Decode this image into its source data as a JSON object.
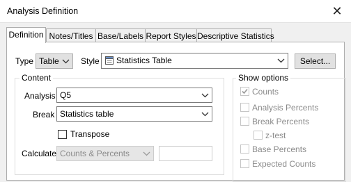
{
  "window": {
    "title": "Analysis Definition",
    "close_glyph": "✕"
  },
  "tabs": [
    {
      "label": "Definition",
      "active": true
    },
    {
      "label": "Notes/Titles",
      "active": false
    },
    {
      "label": "Base/Labels",
      "active": false
    },
    {
      "label": "Report Styles",
      "active": false
    },
    {
      "label": "Descriptive Statistics",
      "active": false
    }
  ],
  "definition": {
    "type_label": "Type",
    "type_value": "Table",
    "style_label": "Style",
    "style_value": "Statistics Table",
    "style_icon": "document-icon",
    "select_button": "Select..."
  },
  "content": {
    "legend": "Content",
    "analysis_label": "Analysis",
    "analysis_value": "Q5",
    "break_label": "Break",
    "break_value": "Statistics table",
    "transpose_label": "Transpose",
    "transpose_checked": false,
    "calculate_label": "Calculate",
    "calculate_value": "Counts & Percents",
    "calculate_extra_value": ""
  },
  "show_options": {
    "legend": "Show options",
    "items": [
      {
        "label": "Counts",
        "checked": true
      },
      {
        "label": "Analysis Percents",
        "checked": false
      },
      {
        "label": "Break Percents",
        "checked": false
      },
      {
        "label": "z-test",
        "checked": false
      },
      {
        "label": "Base Percents",
        "checked": false
      },
      {
        "label": "Expected Counts",
        "checked": false
      }
    ]
  }
}
